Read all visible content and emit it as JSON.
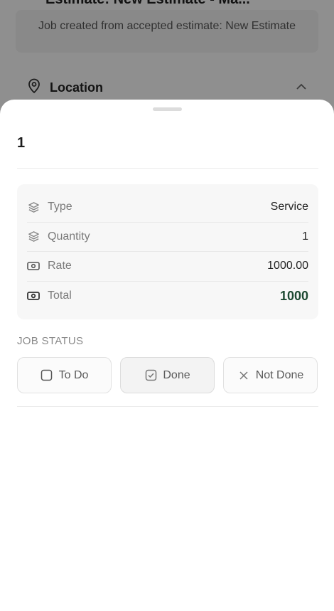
{
  "background": {
    "title": "Estimate: New Estimate - Ma...",
    "note": "Job created from accepted estimate: New Estimate",
    "location_label": "Location"
  },
  "sheet": {
    "title": "1",
    "details": [
      {
        "icon": "layers-icon",
        "label": "Type",
        "value": "Service"
      },
      {
        "icon": "layers-icon",
        "label": "Quantity",
        "value": "1"
      },
      {
        "icon": "banknote-icon",
        "label": "Rate",
        "value": "1000.00"
      },
      {
        "icon": "banknote-icon",
        "label": "Total",
        "value": "1000"
      }
    ],
    "status_heading": "JOB STATUS",
    "status_options": [
      {
        "icon": "checkbox-empty-icon",
        "label": "To Do"
      },
      {
        "icon": "checkbox-checked-icon",
        "label": "Done"
      },
      {
        "icon": "x-icon",
        "label": "Not Done"
      }
    ],
    "selected_status": "Done"
  },
  "colors": {
    "total_value": "#1d4a32",
    "scrim": "rgba(0,0,0,0.42)"
  }
}
